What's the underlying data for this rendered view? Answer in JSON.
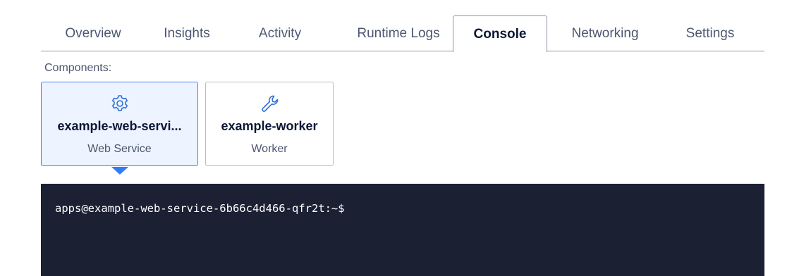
{
  "tabs": [
    {
      "label": "Overview",
      "active": false
    },
    {
      "label": "Insights",
      "active": false
    },
    {
      "label": "Activity",
      "active": false
    },
    {
      "label": "Runtime Logs",
      "active": false
    },
    {
      "label": "Console",
      "active": true
    },
    {
      "label": "Networking",
      "active": false
    },
    {
      "label": "Settings",
      "active": false
    }
  ],
  "components": {
    "label": "Components:",
    "items": [
      {
        "name": "example-web-servi...",
        "type": "Web Service",
        "icon": "gear-icon",
        "selected": true
      },
      {
        "name": "example-worker",
        "type": "Worker",
        "icon": "wrench-icon",
        "selected": false
      }
    ]
  },
  "console": {
    "prompt": "apps@example-web-service-6b66c4d466-qfr2t:~$"
  },
  "colors": {
    "accent": "#3b82f6",
    "terminal_bg": "#1b2033",
    "selected_card_bg": "#edf4ff"
  }
}
